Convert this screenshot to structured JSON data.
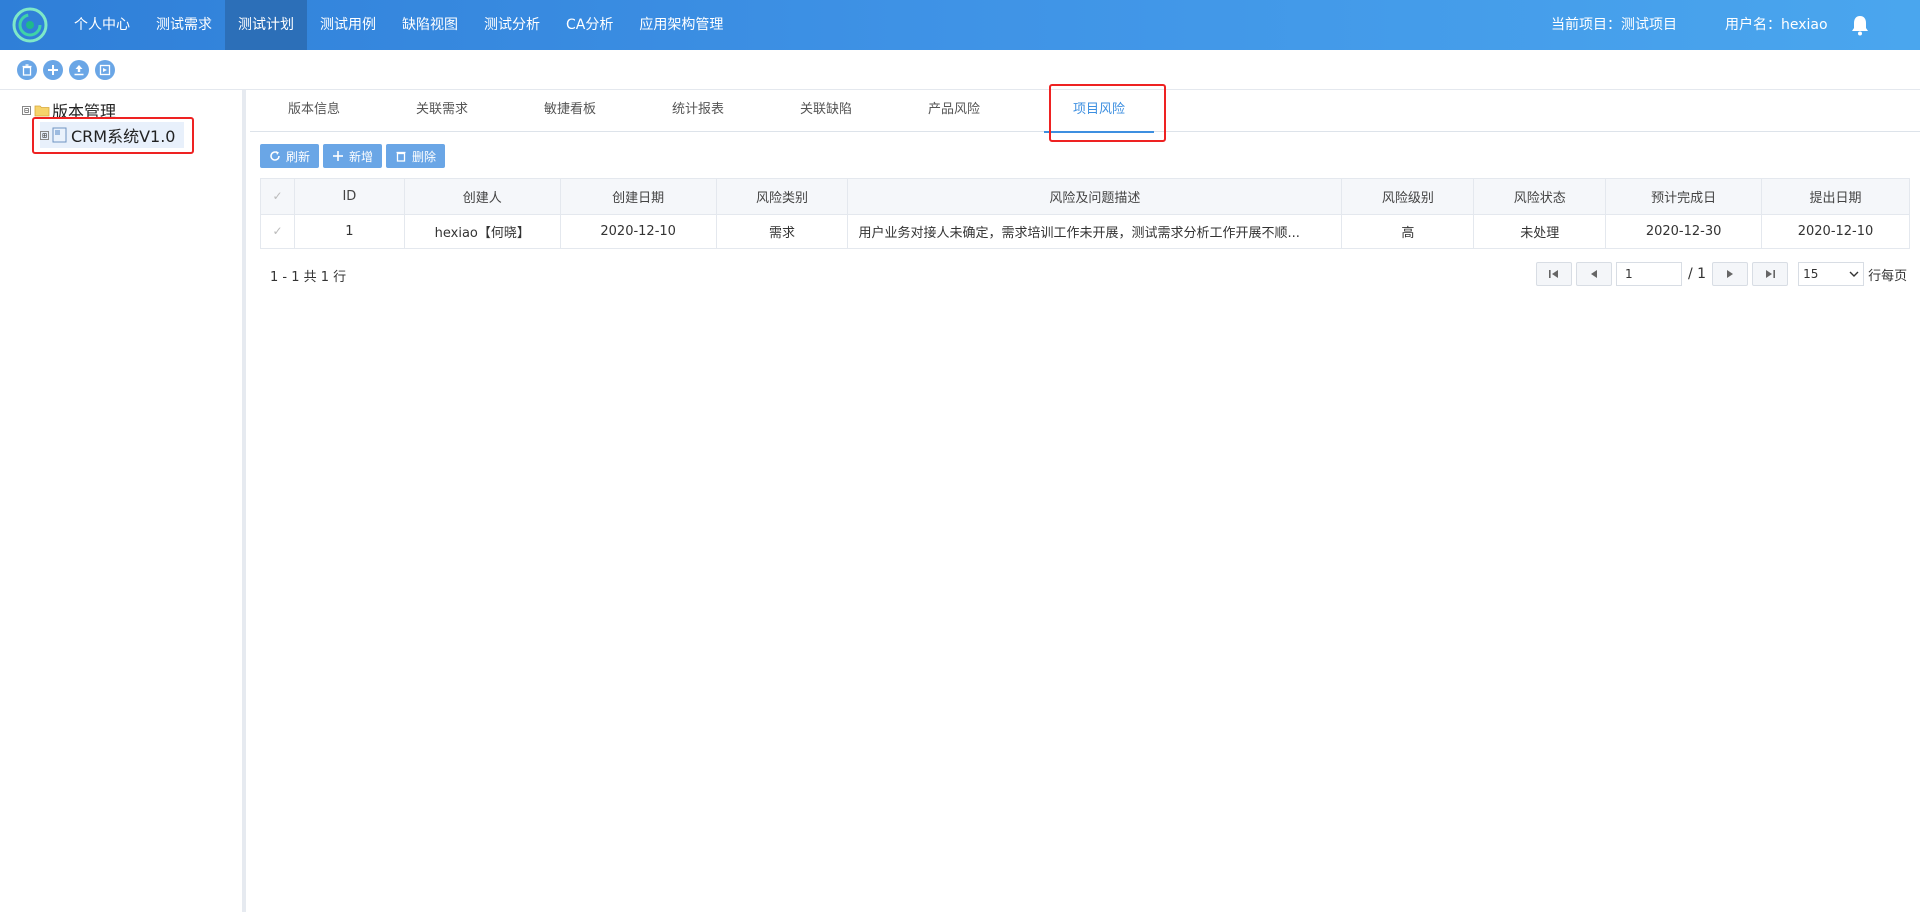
{
  "nav": {
    "items": [
      "个人中心",
      "测试需求",
      "测试计划",
      "测试用例",
      "缺陷视图",
      "测试分析",
      "CA分析",
      "应用架构管理"
    ],
    "active_index": 2,
    "current_project": "当前项目：测试项目",
    "username": "用户名：hexiao"
  },
  "toolbar": {
    "icons": [
      "trash-icon",
      "plus-icon",
      "upload-icon",
      "export-icon"
    ]
  },
  "tree": {
    "root_label": "版本管理",
    "child_label": "CRM系统V1.0",
    "root_expander": "⊟",
    "child_expander": "⊞"
  },
  "tabs": [
    "版本信息",
    "关联需求",
    "敏捷看板",
    "统计报表",
    "关联缺陷",
    "产品风险",
    "项目风险"
  ],
  "active_tab_index": 6,
  "actions": {
    "refresh": "刷新",
    "add": "新增",
    "delete": "删除"
  },
  "table": {
    "columns": [
      "ID",
      "创建人",
      "创建日期",
      "风险类别",
      "风险及问题描述",
      "风险级别",
      "风险状态",
      "预计完成日",
      "提出日期"
    ],
    "rows": [
      [
        "1",
        "hexiao【何晓】",
        "2020-12-10",
        "需求",
        "用户业务对接人未确定，需求培训工作未开展，测试需求分析工作开展不顺...",
        "高",
        "未处理",
        "2020-12-30",
        "2020-12-10"
      ]
    ]
  },
  "pagination": {
    "summary": "1 - 1 共 1 行",
    "current_page": "1",
    "total_pages": "/ 1",
    "page_size": "15",
    "per_page_label": "行每页"
  },
  "colors": {
    "nav_gradient_start": "#2f7fd8",
    "nav_gradient_end": "#4aa6ee",
    "accent": "#3d8fe0",
    "button": "#6aa6e6",
    "highlight": "#ee2222"
  }
}
